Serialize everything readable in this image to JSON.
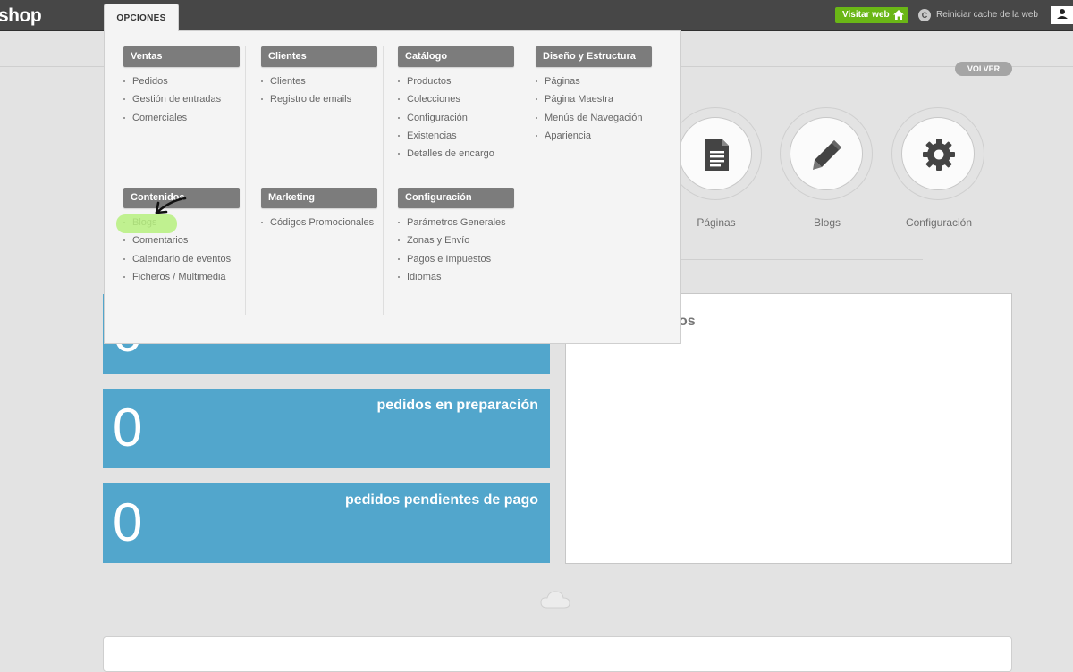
{
  "topbar": {
    "brand": "shop",
    "options_tab": "OPCIONES",
    "visit_web": "Visitar web",
    "reset_cache": "Reiniciar cache de la web",
    "cache_icon_letter": "C"
  },
  "back_button": "VOLVER",
  "shortcuts": [
    {
      "label": "Páginas",
      "icon": "document-icon"
    },
    {
      "label": "Blogs",
      "icon": "pencil-icon"
    },
    {
      "label": "Configuración",
      "icon": "gear-icon"
    }
  ],
  "stats": [
    {
      "value": "0",
      "label": "pedidos en preparación"
    },
    {
      "value": "0",
      "label": "pedidos pendientes de pago"
    }
  ],
  "partial_card_value": "0",
  "right_panel_title_fragment": "os",
  "menu": {
    "sections": [
      {
        "title": "Ventas",
        "items": [
          "Pedidos",
          "Gestión de entradas",
          "Comerciales"
        ]
      },
      {
        "title": "Clientes",
        "items": [
          "Clientes",
          "Registro de emails"
        ]
      },
      {
        "title": "Catálogo",
        "items": [
          "Productos",
          "Colecciones",
          "Configuración",
          "Existencias",
          "Detalles de encargo"
        ]
      },
      {
        "title": "Diseño y Estructura",
        "items": [
          "Páginas",
          "Página Maestra",
          "Menús de Navegación",
          "Apariencia"
        ]
      },
      {
        "title": "Contenidos",
        "items": [
          "Blogs",
          "Comentarios",
          "Calendario de eventos",
          "Ficheros / Multimedia"
        ]
      },
      {
        "title": "Marketing",
        "items": [
          "Códigos Promocionales"
        ]
      },
      {
        "title": "Configuración",
        "items": [
          "Parámetros Generales",
          "Zonas y Envío",
          "Pagos e Impuestos",
          "Idiomas"
        ]
      }
    ]
  },
  "colors": {
    "topbar": "#474747",
    "accent_green": "#6ab616",
    "stat_blue": "#52a6cc",
    "menu_header": "#7c7c7c",
    "highlight": "#b6f07e"
  }
}
